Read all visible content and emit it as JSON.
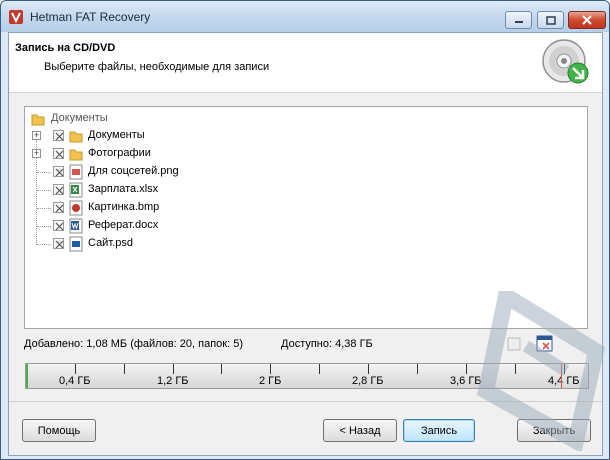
{
  "window": {
    "title": "Hetman FAT Recovery"
  },
  "header": {
    "title": "Запись на CD/DVD",
    "subtitle": "Выберите файлы, необходимые для записи"
  },
  "tree": {
    "root_label": "Документы",
    "items": [
      {
        "label": "Документы",
        "icon": "folder-icon",
        "expandable": true,
        "checked": true
      },
      {
        "label": "Фотографии",
        "icon": "folder-icon",
        "expandable": true,
        "checked": true
      },
      {
        "label": "Для соцсетей.png",
        "icon": "png-file-icon",
        "expandable": false,
        "checked": true
      },
      {
        "label": "Зарплата.xlsx",
        "icon": "excel-file-icon",
        "expandable": false,
        "checked": true
      },
      {
        "label": "Картинка.bmp",
        "icon": "bmp-file-icon",
        "expandable": false,
        "checked": true
      },
      {
        "label": "Реферат.docx",
        "icon": "word-file-icon",
        "expandable": false,
        "checked": true
      },
      {
        "label": "Сайт.psd",
        "icon": "psd-file-icon",
        "expandable": false,
        "checked": true
      }
    ]
  },
  "status": {
    "added": "Добавлено: 1,08 МБ (файлов: 20, папок: 5)",
    "available": "Доступно: 4,38 ГБ"
  },
  "scale": {
    "ticks": [
      "0,4 ГБ",
      "1,2 ГБ",
      "2 ГБ",
      "2,8 ГБ",
      "3,6 ГБ",
      "4,4 ГБ"
    ],
    "used_fraction": 0.0002,
    "limit_gb": 4.38
  },
  "buttons": {
    "help": "Помощь",
    "back": "< Назад",
    "write": "Запись",
    "close": "Закрыть"
  },
  "colors": {
    "accent": "#3c7fb1",
    "used": "#4cae4c",
    "limit": "#d9534f"
  }
}
